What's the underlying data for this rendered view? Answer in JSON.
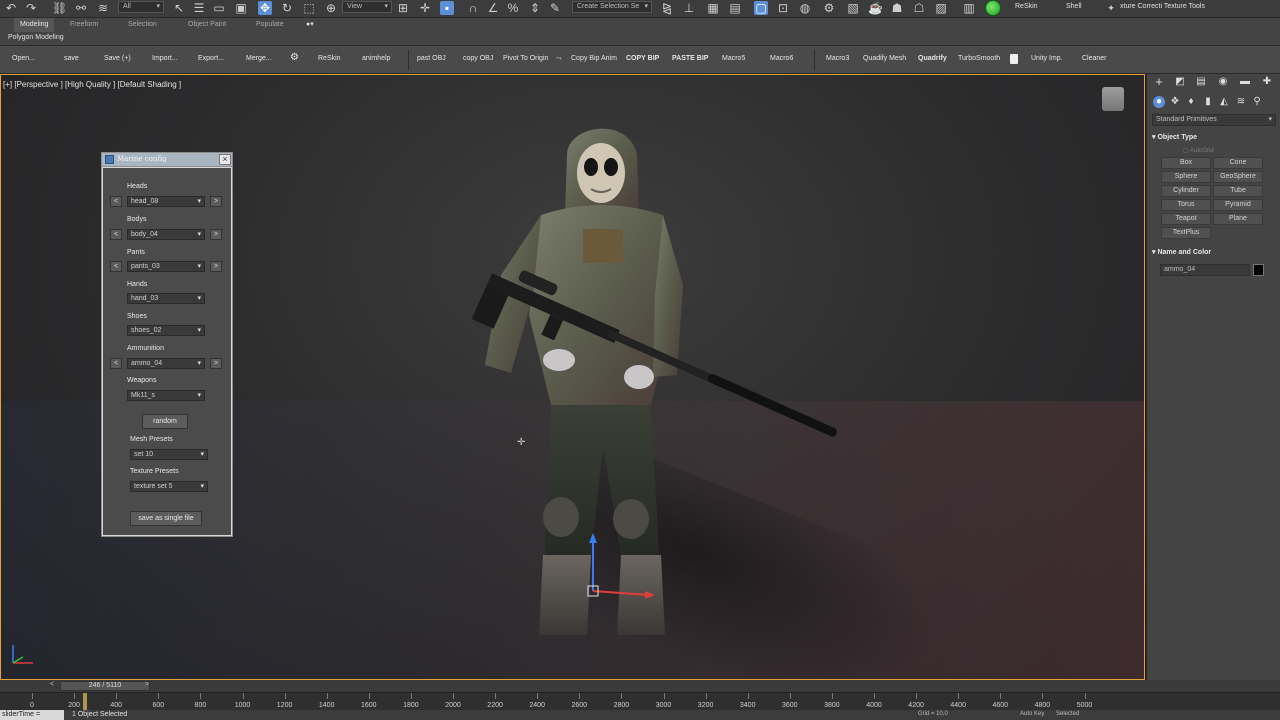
{
  "toolbar": {
    "filter_select": "All",
    "view_select": "View",
    "selection_set": "Create Selection Se",
    "reskin_label": "ReSkin",
    "shell_label": "Shell",
    "texture_tools_label": "xture Correcti Texture Tools"
  },
  "ribbon": {
    "tabs": [
      "Modeling",
      "Freeform",
      "Selection",
      "Object Paint",
      "Populate"
    ],
    "active_panel": "Polygon Modeling"
  },
  "macros": [
    "Open...",
    "save",
    "Save (+)",
    "Import...",
    "Export...",
    "Merge...",
    "ReSkin",
    "animhelp",
    "past OBJ",
    "copy OBJ",
    "Pivot To Origin",
    "Copy Bip Anim",
    "COPY BIP",
    "PASTE BIP",
    "Macro5",
    "Macro6",
    "Macro3",
    "Quadify Mesh",
    "Quadrify",
    "TurboSmooth",
    "Unity Imp.",
    "Cleaner"
  ],
  "viewport": {
    "label": "[+] [Perspective ] [High Quality ] [Default Shading ]"
  },
  "marine_config": {
    "title": "Marine config",
    "heads_label": "Heads",
    "heads_value": "head_08",
    "bodys_label": "Bodys",
    "bodys_value": "body_04",
    "pants_label": "Pants",
    "pants_value": "pants_03",
    "hands_label": "Hands",
    "hands_value": "hand_03",
    "shoes_label": "Shoes",
    "shoes_value": "shoes_02",
    "ammo_label": "Ammunition",
    "ammo_value": "ammo_04",
    "weapons_label": "Weapons",
    "weapons_value": "Mk11_s",
    "random_label": "random",
    "mesh_presets_label": "Mesh Presets",
    "mesh_presets_value": "set 10",
    "texture_presets_label": "Texture Presets",
    "texture_presets_value": "texture set 5",
    "save_label": "save as single file",
    "prev": "<",
    "next": ">"
  },
  "command_panel": {
    "category": "Standard Primitives",
    "object_type_label": "Object Type",
    "autogrid_label": "AutoGrid",
    "primitives": [
      "Box",
      "Cone",
      "Sphere",
      "GeoSphere",
      "Cylinder",
      "Tube",
      "Torus",
      "Pyramid",
      "Teapot",
      "Plane",
      "TextPlus"
    ],
    "name_color_label": "Name and Color",
    "object_name": "ammo_04",
    "object_color": "#000000"
  },
  "timeline": {
    "frame_display": "246 / 5110",
    "ticks": [
      "0",
      "200",
      "400",
      "600",
      "800",
      "1000",
      "1200",
      "1400",
      "1600",
      "1800",
      "2000",
      "2200",
      "2400",
      "2600",
      "2800",
      "3000",
      "3200",
      "3400",
      "3600",
      "3800",
      "4000",
      "4200",
      "4400",
      "4600",
      "4800",
      "5000"
    ]
  },
  "status": {
    "script_input": "sliderTime =",
    "selection_text": "1 Object Selected",
    "auto_key": "Auto Key",
    "selected": "Selected",
    "grid": "Grid = 10,0"
  },
  "colors": {
    "accent": "#5b8fd6",
    "viewport_border": "#e8a233"
  }
}
